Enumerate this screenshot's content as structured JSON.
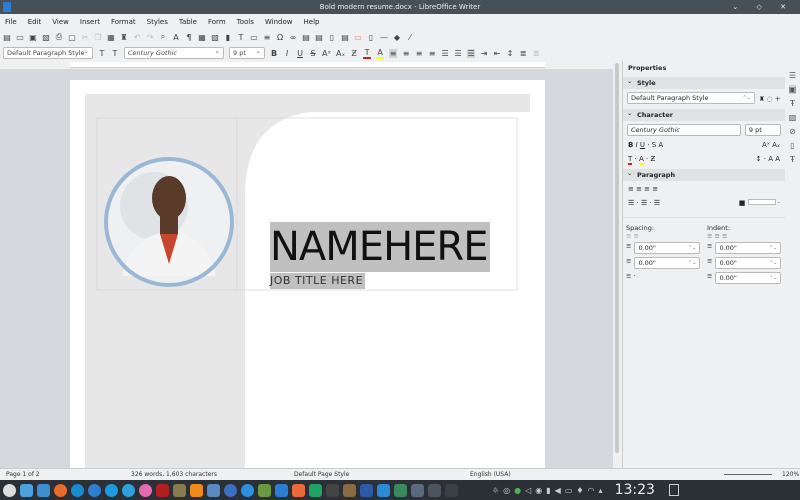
{
  "window": {
    "title": "Bold modern resume.docx - LibreOffice Writer",
    "controls": "⌄ ◇ ✕"
  },
  "menu": [
    "File",
    "Edit",
    "View",
    "Insert",
    "Format",
    "Styles",
    "Table",
    "Form",
    "Tools",
    "Window",
    "Help"
  ],
  "toolbar2": {
    "paragraph_style": "Default Paragraph Style",
    "font_name": "Century Gothic",
    "font_size": "9 pt"
  },
  "document": {
    "name": "NAMEHERE",
    "job_title": "JOB TITLE HERE"
  },
  "sidebar": {
    "title": "Properties",
    "style_section": "Style",
    "style_value": "Default Paragraph Style",
    "character_section": "Character",
    "font_name": "Century Gothic",
    "font_size": "9 pt",
    "paragraph_section": "Paragraph",
    "spacing_label": "Spacing:",
    "indent_label": "Indent:",
    "spacing_above": "0.00\"",
    "spacing_below": "0.00\"",
    "indent_before": "0.00\"",
    "indent_after": "0.00\"",
    "indent_first": "0.00\""
  },
  "status": {
    "page": "Page 1 of 2",
    "words": "326 words, 1,603 characters",
    "page_style": "Default Page Style",
    "language": "English (USA)",
    "zoom": "120%"
  },
  "taskbar": {
    "clock": "13:23"
  },
  "colors": {
    "highlight": "#c0c0c0",
    "photo_border": "#9ab8d6",
    "shape_gray": "#e8e7e7"
  }
}
